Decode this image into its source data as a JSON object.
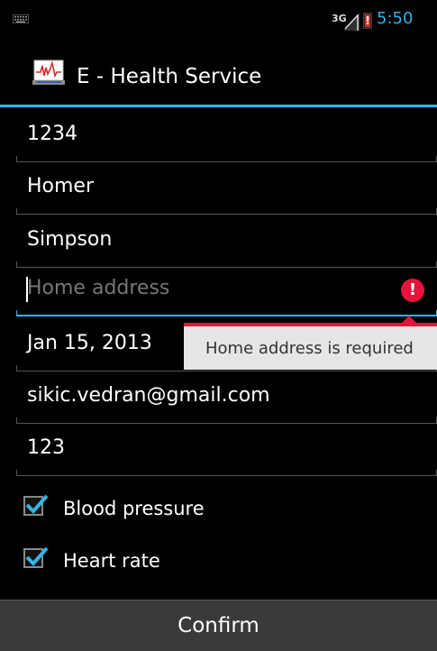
{
  "status_bar": {
    "keyboard_icon": "keyboard-icon",
    "network": "3G",
    "battery_icon": "battery-alert-icon",
    "battery_glyph": "!",
    "time": "5:50",
    "accent_color": "#33b5e5"
  },
  "action_bar": {
    "app_icon": "heart-monitor-icon",
    "title": "E - Health Service"
  },
  "form": {
    "fields": [
      {
        "value": "1234"
      },
      {
        "value": "Homer"
      },
      {
        "value": "Simpson"
      },
      {
        "placeholder": "Home address",
        "value": ""
      },
      {
        "value": "Jan 15, 2013"
      },
      {
        "value": "sikic.vedran@gmail.com"
      },
      {
        "value": "123"
      }
    ],
    "error": {
      "icon": "error-alert-icon",
      "glyph": "!",
      "message": "Home address is required",
      "color": "#e8133b"
    },
    "checkboxes": [
      {
        "label": "Blood pressure",
        "checked": true
      },
      {
        "label": "Heart rate",
        "checked": true
      }
    ],
    "confirm_label": "Confirm"
  }
}
